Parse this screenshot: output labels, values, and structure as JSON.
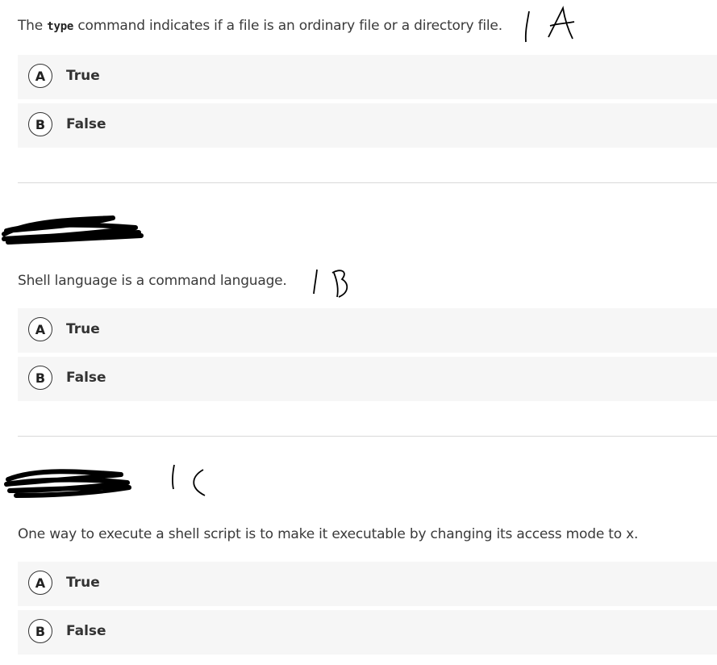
{
  "questions": [
    {
      "text_before": "The ",
      "code": "type",
      "text_after": " command indicates if a file is an ordinary file or a directory file.",
      "options": [
        {
          "letter": "A",
          "label": "True"
        },
        {
          "letter": "B",
          "label": "False"
        }
      ]
    },
    {
      "text": "Shell language is a command language.",
      "options": [
        {
          "letter": "A",
          "label": "True"
        },
        {
          "letter": "B",
          "label": "False"
        }
      ]
    },
    {
      "text": "One way to execute a shell script is to make it executable by changing its access mode to x.",
      "options": [
        {
          "letter": "A",
          "label": "True"
        },
        {
          "letter": "B",
          "label": "False"
        }
      ]
    }
  ],
  "handwritten_annotations": [
    "| A",
    "| B",
    "| C"
  ],
  "colors": {
    "option_background": "#f6f6f6",
    "text": "#3a3a3a",
    "divider": "#d9d9d9",
    "ink": "#000000"
  }
}
